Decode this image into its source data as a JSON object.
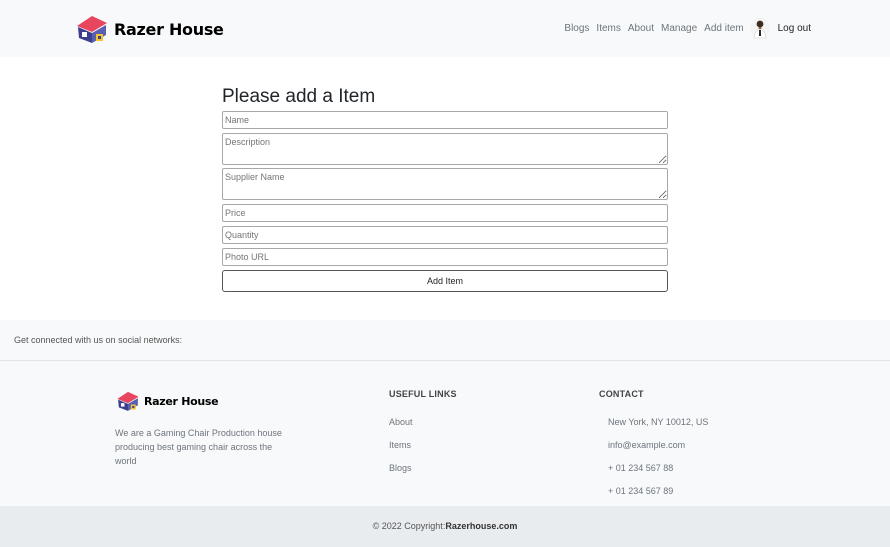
{
  "brand": {
    "name": "Razer House"
  },
  "nav": {
    "items": [
      "Blogs",
      "Items",
      "About",
      "Manage",
      "Add item"
    ],
    "logout": "Log out"
  },
  "form": {
    "title": "Please add a Item",
    "placeholders": {
      "name": "Name",
      "description": "Description",
      "supplier": "Supplier Name",
      "price": "Price",
      "quantity": "Quantity",
      "photo": "Photo URL"
    },
    "submit_label": "Add Item"
  },
  "social": {
    "text": "Get connected with us on social networks:"
  },
  "footer": {
    "brand": "Razer House",
    "about": "We are a Gaming Chair Production house producing best gaming chair across the world",
    "links_heading": "USEFUL LINKS",
    "links": [
      "About",
      "Items",
      "Blogs"
    ],
    "contact_heading": "CONTACT",
    "contact": [
      "New York, NY 10012, US",
      "info@example.com",
      "+ 01 234 567 88",
      "+ 01 234 567 89"
    ]
  },
  "copyright": {
    "prefix": "© 2022 Copyright:",
    "site": "Razerhouse.com"
  },
  "colors": {
    "logo_roof": "#e8455f",
    "logo_wall": "#3b3f8c",
    "logo_accent": "#f4c430"
  }
}
